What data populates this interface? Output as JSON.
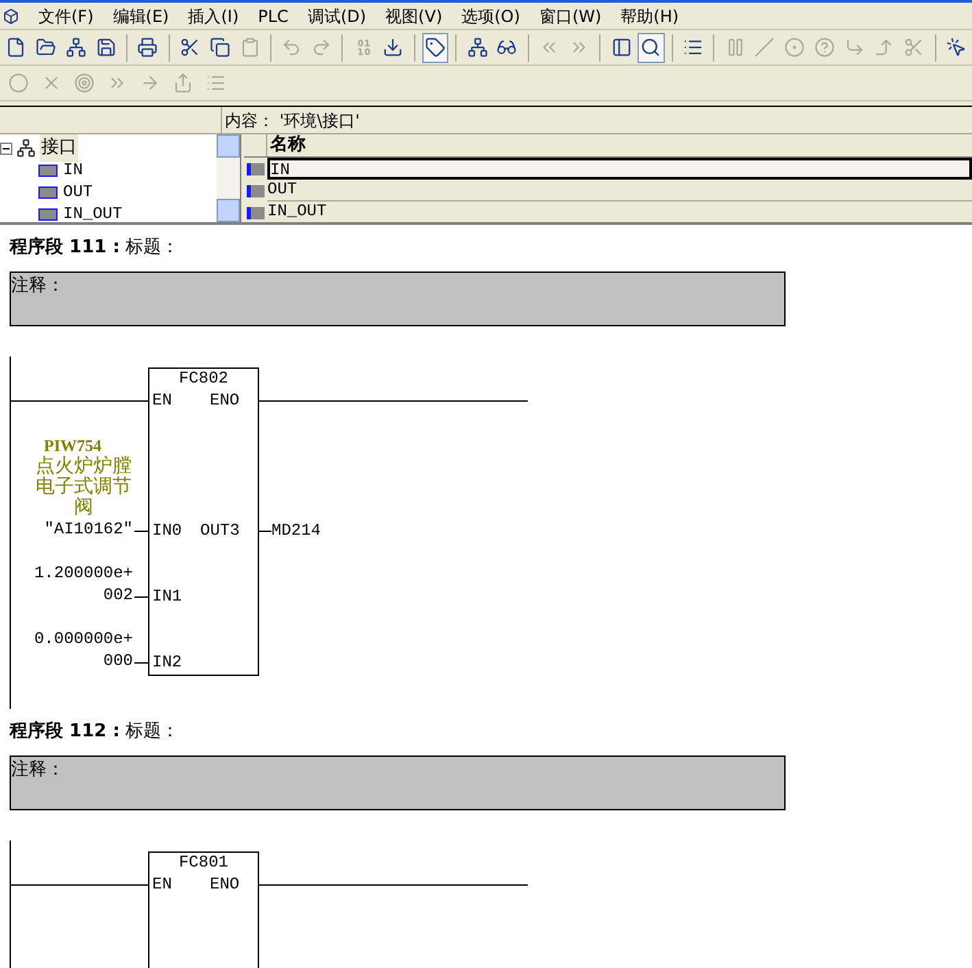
{
  "menu": [
    "文件(F)",
    "编辑(E)",
    "插入(I)",
    "PLC",
    "调试(D)",
    "视图(V)",
    "选项(O)",
    "窗口(W)",
    "帮助(H)"
  ],
  "toolbar_1": [
    {
      "kind": "new",
      "disabled": false,
      "pressed": false
    },
    {
      "kind": "open",
      "disabled": false,
      "pressed": false
    },
    {
      "kind": "network",
      "disabled": false,
      "pressed": false
    },
    {
      "kind": "save",
      "disabled": false,
      "pressed": false
    },
    {
      "kind": "sep"
    },
    {
      "kind": "print",
      "disabled": false,
      "pressed": false
    },
    {
      "kind": "sep"
    },
    {
      "kind": "cut",
      "disabled": false,
      "pressed": false
    },
    {
      "kind": "copy",
      "disabled": false,
      "pressed": false
    },
    {
      "kind": "paste",
      "disabled": true,
      "pressed": false
    },
    {
      "kind": "sep"
    },
    {
      "kind": "undo",
      "disabled": true,
      "pressed": false
    },
    {
      "kind": "redo",
      "disabled": true,
      "pressed": false
    },
    {
      "kind": "sep"
    },
    {
      "kind": "binary",
      "disabled": true,
      "pressed": false
    },
    {
      "kind": "download",
      "disabled": false,
      "pressed": false
    },
    {
      "kind": "sep"
    },
    {
      "kind": "tag",
      "disabled": false,
      "pressed": true
    },
    {
      "kind": "sep"
    },
    {
      "kind": "network",
      "disabled": false,
      "pressed": false
    },
    {
      "kind": "glasses",
      "disabled": false,
      "pressed": false
    },
    {
      "kind": "sep"
    },
    {
      "kind": "back",
      "disabled": true,
      "pressed": false
    },
    {
      "kind": "forward",
      "disabled": true,
      "pressed": false
    },
    {
      "kind": "sep"
    },
    {
      "kind": "panel",
      "disabled": false,
      "pressed": false
    },
    {
      "kind": "zoom",
      "disabled": false,
      "pressed": true
    },
    {
      "kind": "sep"
    },
    {
      "kind": "list",
      "disabled": false,
      "pressed": false
    },
    {
      "kind": "sep"
    },
    {
      "kind": "contact",
      "disabled": true,
      "pressed": false
    },
    {
      "kind": "slash",
      "disabled": true,
      "pressed": false
    },
    {
      "kind": "coil",
      "disabled": true,
      "pressed": false
    },
    {
      "kind": "help-box",
      "disabled": true,
      "pressed": false
    },
    {
      "kind": "branch-down",
      "disabled": true,
      "pressed": false
    },
    {
      "kind": "branch-up",
      "disabled": true,
      "pressed": false
    },
    {
      "kind": "span",
      "disabled": true,
      "pressed": false
    },
    {
      "kind": "sep"
    },
    {
      "kind": "pointer-help",
      "disabled": false,
      "pressed": false
    }
  ],
  "toolbar_2": [
    {
      "kind": "dot",
      "disabled": true,
      "pressed": false
    },
    {
      "kind": "x",
      "disabled": true,
      "pressed": false
    },
    {
      "kind": "target",
      "disabled": true,
      "pressed": false
    },
    {
      "kind": "forward",
      "disabled": true,
      "pressed": false
    },
    {
      "kind": "arrow",
      "disabled": true,
      "pressed": false
    },
    {
      "kind": "share",
      "disabled": true,
      "pressed": false
    },
    {
      "kind": "list",
      "disabled": true,
      "pressed": false
    }
  ],
  "content_header": "内容： '环境\\接口'",
  "tree": [
    {
      "label": "接口",
      "expanded": true,
      "children": [
        {
          "label": "IN"
        },
        {
          "label": "OUT"
        },
        {
          "label": "IN_OUT"
        }
      ]
    }
  ],
  "table": {
    "column": "名称",
    "rows": [
      {
        "name": "IN",
        "selected": true
      },
      {
        "name": "OUT",
        "selected": false
      },
      {
        "name": "IN_OUT",
        "selected": false
      }
    ]
  },
  "networks": [
    {
      "title": "**程序段 111 :** 标题：",
      "comment": "注释：",
      "block": {
        "name": "FC802",
        "en": "EN",
        "eno": "ENO",
        "inputs": [
          {
            "pin": "IN0",
            "operand": "″AI10162″",
            "symbol": "PIW754",
            "symbol_comment": "点火炉炉膛电子式调节阀"
          },
          {
            "pin": "IN1",
            "operand": "1.200000e+002"
          },
          {
            "pin": "IN2",
            "operand": "0.000000e+000"
          }
        ],
        "outputs": [
          {
            "pin": "OUT3",
            "operand": "MD214"
          }
        ]
      }
    },
    {
      "title": "**程序段 112 :** 标题：",
      "comment": "注释：",
      "block": {
        "name": "FC801",
        "en": "EN",
        "eno": "ENO"
      }
    }
  ]
}
